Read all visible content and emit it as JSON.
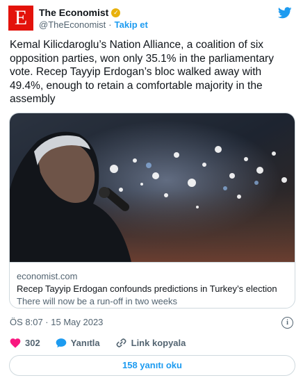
{
  "author": {
    "logo_letter": "E",
    "name": "The Economist",
    "handle": "@TheEconomist",
    "separator": "·",
    "follow_label": "Takip et"
  },
  "tweet": {
    "text": "Kemal Kilicdaroglu’s Nation Alliance, a coalition of six opposition parties, won only 35.1% in the parliamentary vote. Recep Tayyip Erdogan’s bloc walked away with 49.4%, enough to retain a comfortable majority in the assembly"
  },
  "card": {
    "domain": "economist.com",
    "title": "Recep Tayyip Erdogan confounds predictions in Turkey’s election",
    "description": "There will now be a run-off in two weeks"
  },
  "timestamp": "ÖS 8:07 · 15 May 2023",
  "actions": {
    "likes": "302",
    "reply_label": "Yanıtla",
    "copy_link_label": "Link kopyala"
  },
  "read_replies": "158 yanıtı oku",
  "colors": {
    "brand": "#e3120b",
    "accent": "#1d9bf0",
    "like": "#f91880",
    "muted": "#536471"
  },
  "icons": [
    "twitter-bird-icon",
    "verified-badge-icon",
    "info-icon",
    "heart-icon",
    "reply-icon",
    "link-icon"
  ]
}
